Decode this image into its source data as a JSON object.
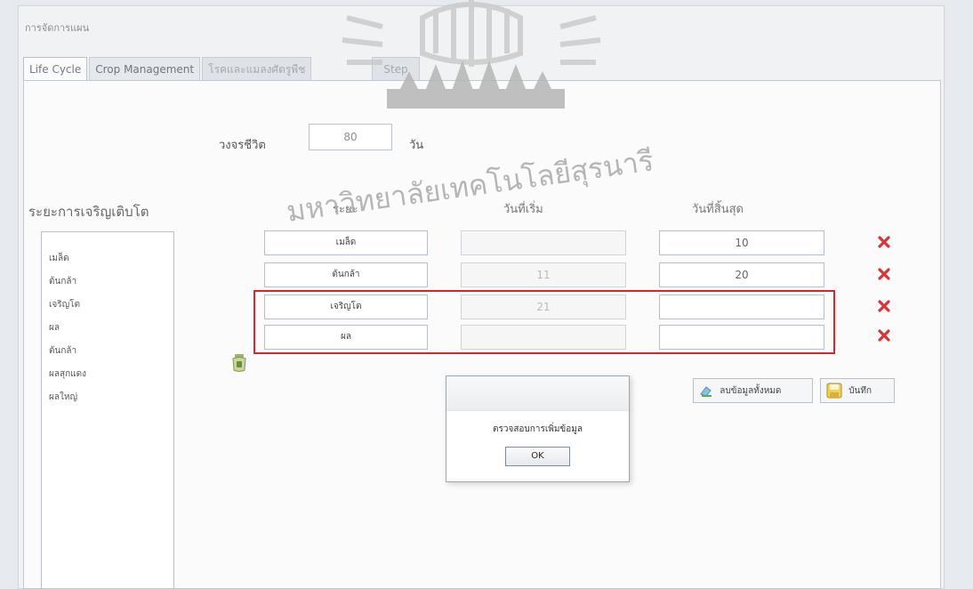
{
  "window": {
    "title": "การจัดการแผน"
  },
  "tabs": [
    {
      "label": "Life Cycle",
      "active": true
    },
    {
      "label": "Crop Management",
      "active": false
    },
    {
      "label": "โรคและแมลงศัตรูพืช",
      "active": false
    },
    {
      "label": "Step",
      "active": false
    }
  ],
  "lifecycle": {
    "label": "วงจรชีวิต",
    "value": "80",
    "unit": "วัน"
  },
  "stages_panel": {
    "title": "ระยะการเจริญเติบโต",
    "items": [
      "เมล็ด",
      "ต้นกล้า",
      "เจริญโต",
      "ผล",
      "ต้นกล้า",
      "ผลสุกแดง",
      "ผลใหญ่"
    ]
  },
  "table": {
    "headers": {
      "stage": "ระยะ",
      "start": "วันที่เริ่ม",
      "end": "วันที่สิ้นสุด"
    },
    "rows": [
      {
        "stage": "เมล็ด",
        "start": "",
        "end": "10"
      },
      {
        "stage": "ต้นกล้า",
        "start": "11",
        "end": "20"
      },
      {
        "stage": "เจริญโต",
        "start": "21",
        "end": ""
      },
      {
        "stage": "ผล",
        "start": "",
        "end": ""
      }
    ]
  },
  "buttons": {
    "reset": "ลบข้อมูลทั้งหมด",
    "save": "บันทึก"
  },
  "dialog": {
    "message": "ตรวจสอบการเพิ่มข้อมูล",
    "ok": "OK"
  },
  "watermark": {
    "text": "มหาวิทยาลัยเทคโนโลยีสุรนารี"
  },
  "colors": {
    "highlight": "#d9262e",
    "delete": "#d9333a"
  },
  "icons": {
    "delete": "close-x-icon",
    "add": "add-row-icon",
    "reset": "eraser-icon",
    "save": "save-disk-icon"
  }
}
